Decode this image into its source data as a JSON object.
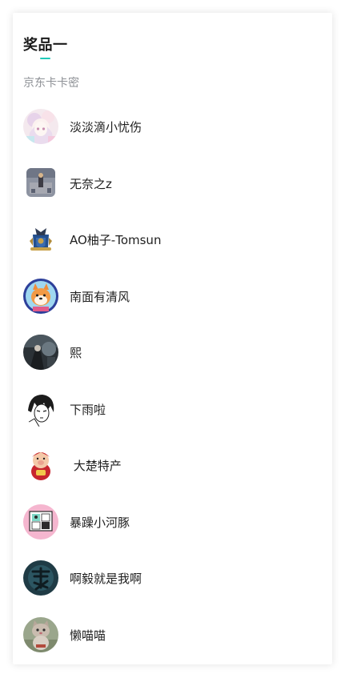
{
  "prize": {
    "title": "奖品一",
    "accent_color": "#1fc9b8",
    "subtitle": "京东卡卡密"
  },
  "winners": [
    {
      "name": "淡淡滴小忧伤",
      "avatar": "anime-girl-avatar-icon"
    },
    {
      "name": "无奈之z",
      "avatar": "game-scene-avatar-icon"
    },
    {
      "name": "AO柚子-Tomsun",
      "avatar": "crest-badge-avatar-icon"
    },
    {
      "name": "南面有清风",
      "avatar": "shiba-dog-avatar-icon"
    },
    {
      "name": "熙",
      "avatar": "dark-scene-avatar-icon"
    },
    {
      "name": "下雨啦",
      "avatar": "manga-boy-avatar-icon"
    },
    {
      "name": " 大楚特产",
      "avatar": "lucky-pig-avatar-icon"
    },
    {
      "name": "暴躁小河豚",
      "avatar": "pink-frame-avatar-icon"
    },
    {
      "name": "啊毅就是我啊",
      "avatar": "calligraphy-avatar-icon"
    },
    {
      "name": "懒喵喵",
      "avatar": "cat-mascot-avatar-icon"
    }
  ]
}
